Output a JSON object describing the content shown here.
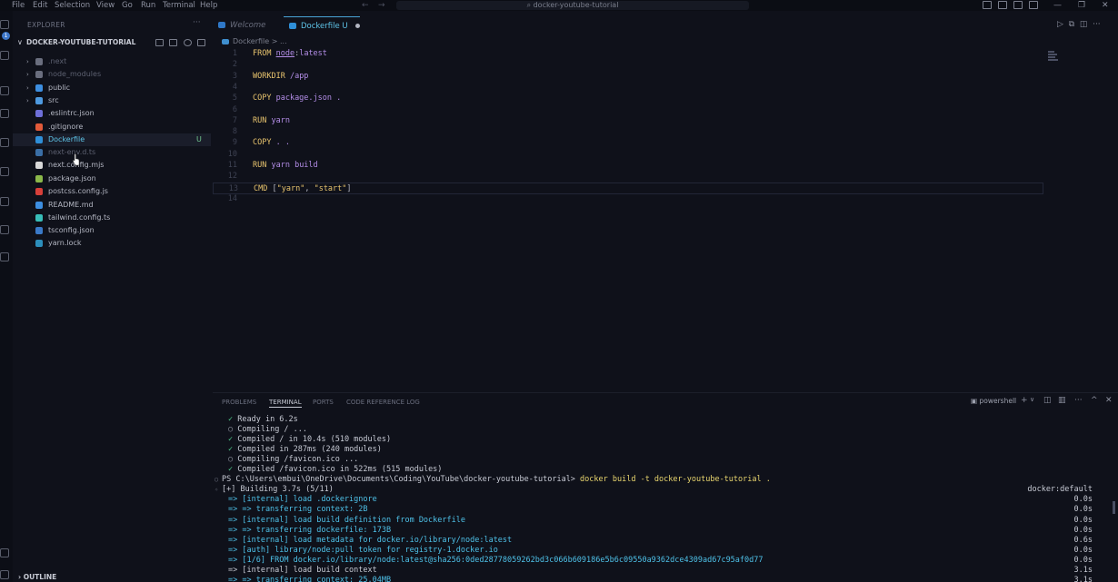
{
  "menu": [
    "File",
    "Edit",
    "Selection",
    "View",
    "Go",
    "Run",
    "Terminal",
    "Help"
  ],
  "search": {
    "text": "docker-youtube-tutorial"
  },
  "activity_badge": "1",
  "explorer": {
    "title": "EXPLORER",
    "project": "DOCKER-YOUTUBE-TUTORIAL",
    "items": [
      {
        "label": ".next",
        "folder": true,
        "dim": true,
        "color": "#6a6e7e"
      },
      {
        "label": "node_modules",
        "folder": true,
        "dim": true,
        "color": "#6a6e7e"
      },
      {
        "label": "public",
        "folder": true,
        "dim": false,
        "color": "#3d8ee0"
      },
      {
        "label": "src",
        "folder": true,
        "dim": false,
        "color": "#4e9ae0"
      },
      {
        "label": ".eslintrc.json",
        "folder": false,
        "dim": false,
        "color": "#6e6fd8"
      },
      {
        "label": ".gitignore",
        "folder": false,
        "dim": false,
        "color": "#e25a3a"
      },
      {
        "label": "Dockerfile",
        "folder": false,
        "dim": false,
        "color": "#2f8fd8",
        "selected": true,
        "badge": "U"
      },
      {
        "label": "next-env.d.ts",
        "folder": false,
        "dim": true,
        "color": "#3a6ea5"
      },
      {
        "label": "next.config.mjs",
        "folder": false,
        "dim": false,
        "color": "#d8d8d8"
      },
      {
        "label": "package.json",
        "folder": false,
        "dim": false,
        "color": "#8bb84a"
      },
      {
        "label": "postcss.config.js",
        "folder": false,
        "dim": false,
        "color": "#d8403a"
      },
      {
        "label": "README.md",
        "folder": false,
        "dim": false,
        "color": "#3d8ee0"
      },
      {
        "label": "tailwind.config.ts",
        "folder": false,
        "dim": false,
        "color": "#38bdb8"
      },
      {
        "label": "tsconfig.json",
        "folder": false,
        "dim": false,
        "color": "#3a7ac8"
      },
      {
        "label": "yarn.lock",
        "folder": false,
        "dim": false,
        "color": "#2c8ebb"
      }
    ],
    "outline": "OUTLINE"
  },
  "tabs": [
    {
      "label": "Welcome",
      "active": false
    },
    {
      "label": "Dockerfile U",
      "active": true
    }
  ],
  "breadcrumb": {
    "file": "Dockerfile",
    "sep": ">",
    "more": "..."
  },
  "code": [
    {
      "n": "1",
      "parts": [
        [
          "kw",
          "FROM "
        ],
        [
          "img",
          "node"
        ],
        [
          "plain",
          ":"
        ],
        [
          "tag",
          "latest"
        ]
      ]
    },
    {
      "n": "2",
      "parts": []
    },
    {
      "n": "3",
      "parts": [
        [
          "kw",
          "WORKDIR "
        ],
        [
          "cmd",
          "/app"
        ]
      ]
    },
    {
      "n": "4",
      "parts": []
    },
    {
      "n": "5",
      "parts": [
        [
          "kw",
          "COPY "
        ],
        [
          "cmd",
          "package.json ."
        ]
      ]
    },
    {
      "n": "6",
      "parts": []
    },
    {
      "n": "7",
      "parts": [
        [
          "kw",
          "RUN "
        ],
        [
          "cmd",
          "yarn"
        ]
      ]
    },
    {
      "n": "8",
      "parts": []
    },
    {
      "n": "9",
      "parts": [
        [
          "kw",
          "COPY "
        ],
        [
          "cmd",
          ". ."
        ]
      ]
    },
    {
      "n": "10",
      "parts": []
    },
    {
      "n": "11",
      "parts": [
        [
          "kw",
          "RUN "
        ],
        [
          "cmd",
          "yarn build"
        ]
      ]
    },
    {
      "n": "12",
      "parts": []
    },
    {
      "n": "13",
      "parts": [
        [
          "kw",
          "CMD "
        ],
        [
          "plain",
          "["
        ],
        [
          "str",
          "\"yarn\""
        ],
        [
          "plain",
          ", "
        ],
        [
          "str",
          "\"start\""
        ],
        [
          "plain",
          "]"
        ]
      ],
      "current": true
    },
    {
      "n": "14",
      "parts": []
    }
  ],
  "panel": {
    "tabs": [
      "PROBLEMS",
      "TERMINAL",
      "PORTS",
      "CODE REFERENCE LOG"
    ],
    "active_tab": "TERMINAL",
    "shell": "powershell"
  },
  "terminal": [
    {
      "mark": "check",
      "text": "Ready in 6.2s"
    },
    {
      "mark": "circ",
      "text": "Compiling / ..."
    },
    {
      "mark": "check",
      "text": "Compiled / in 10.4s (510 modules)"
    },
    {
      "mark": "check",
      "text": "Compiled in 287ms (240 modules)"
    },
    {
      "mark": "circ",
      "text": "Compiling /favicon.ico ..."
    },
    {
      "mark": "check",
      "text": "Compiled /favicon.ico in 522ms (515 modules)"
    },
    {
      "type": "ps",
      "prompt": "PS C:\\Users\\embui\\OneDrive\\Documents\\Coding\\YouTube\\docker-youtube-tutorial> ",
      "command": "docker build -t docker-youtube-tutorial ."
    },
    {
      "type": "build",
      "text": "[+] Building 3.7s (5/11)",
      "right": "docker:default"
    },
    {
      "type": "step",
      "text": "=> [internal] load .dockerignore",
      "time": "0.0s"
    },
    {
      "type": "step",
      "text": "=> => transferring context: 2B",
      "time": "0.0s"
    },
    {
      "type": "step",
      "text": "=> [internal] load build definition from Dockerfile",
      "time": "0.0s"
    },
    {
      "type": "step",
      "text": "=> => transferring dockerfile: 173B",
      "time": "0.0s"
    },
    {
      "type": "step",
      "text": "=> [internal] load metadata for docker.io/library/node:latest",
      "time": "0.6s"
    },
    {
      "type": "step",
      "text": "=> [auth] library/node:pull token for registry-1.docker.io",
      "time": "0.0s"
    },
    {
      "type": "step",
      "text": "=> [1/6] FROM docker.io/library/node:latest@sha256:0ded28778059262bd3c066b609186e5b6c09550a9362dce4309ad67c95af0d77",
      "time": "0.0s"
    },
    {
      "type": "plain",
      "text": "=> [internal] load build context",
      "time": "3.1s"
    },
    {
      "type": "step",
      "text": "=> => transferring context: 25.04MB",
      "time": "3.1s"
    }
  ]
}
